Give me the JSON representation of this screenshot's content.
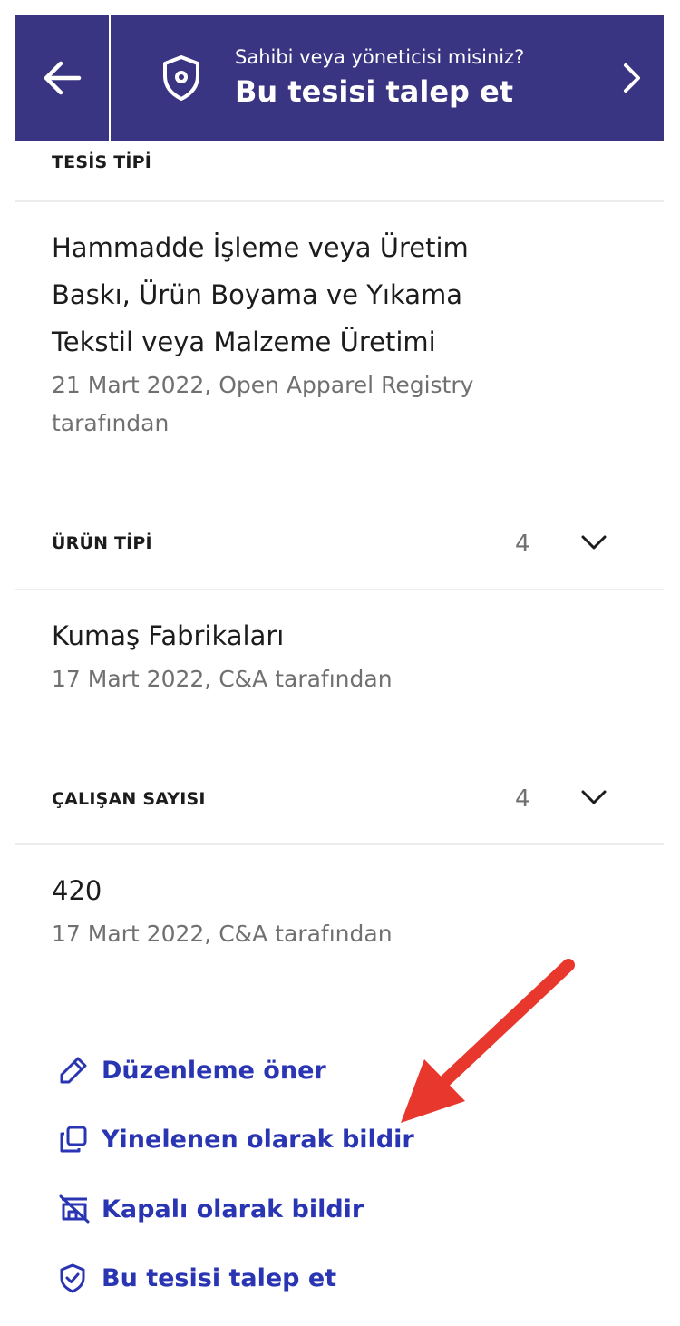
{
  "banner": {
    "back_icon": "arrow-left-icon",
    "shield_icon": "shield-icon",
    "question": "Sahibi veya yöneticisi misiniz?",
    "title": "Bu tesisi talep et",
    "chevron_icon": "chevron-right-icon",
    "background": "#3a3582"
  },
  "facility_type": {
    "label": "TESİS TİPİ",
    "values": [
      "Hammadde İşleme veya Üretim",
      "Baskı, Ürün Boyama ve Yıkama",
      "Tekstil veya Malzeme Üretimi"
    ],
    "meta_line1": "21 Mart 2022, Open Apparel Registry",
    "meta_line2": "tarafından"
  },
  "product_type": {
    "label": "ÜRÜN TİPİ",
    "count": "4",
    "value": "Kumaş Fabrikaları",
    "meta": "17 Mart 2022, C&A tarafından"
  },
  "employees": {
    "label": "ÇALIŞAN SAYISI",
    "count": "4",
    "value": "420",
    "meta": "17 Mart 2022, C&A tarafından"
  },
  "actions": [
    {
      "icon": "pencil-icon",
      "label": "Düzenleme öner"
    },
    {
      "icon": "duplicate-icon",
      "label": "Yinelenen olarak bildir"
    },
    {
      "icon": "closed-store-icon",
      "label": "Kapalı olarak bildir"
    },
    {
      "icon": "shield-check-icon",
      "label": "Bu tesisi talep et"
    }
  ],
  "colors": {
    "accent": "#3a3582",
    "link": "#2a35b3",
    "annotation_arrow": "#e8372c"
  }
}
